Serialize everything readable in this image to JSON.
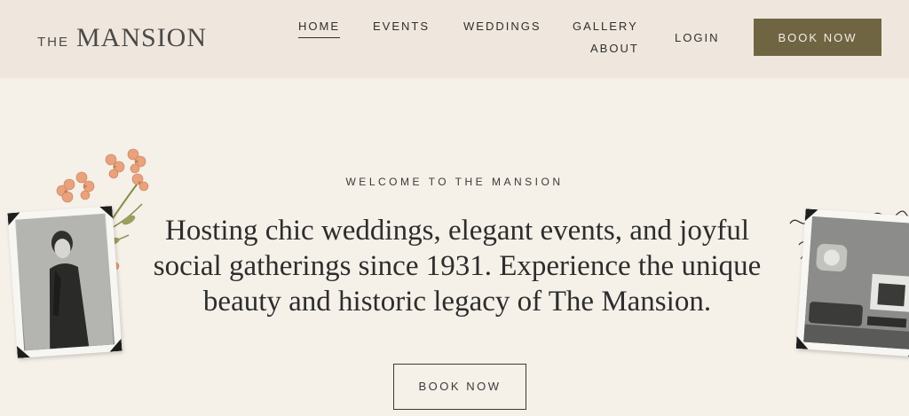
{
  "header": {
    "logo_small": "THE",
    "logo_big": "MANSION",
    "nav": {
      "home": "HOME",
      "events": "EVENTS",
      "weddings": "WEDDINGS",
      "gallery": "GALLERY",
      "about": "ABOUT",
      "login": "LOGIN"
    },
    "book_button": "BOOK NOW"
  },
  "hero": {
    "kicker": "WELCOME TO THE MANSION",
    "headline": "Hosting chic weddings, elegant events, and joyful social gatherings since 1931. Experience the unique beauty and historic legacy of The Mansion.",
    "book_button": "BOOK NOW"
  },
  "colors": {
    "header_bg": "#efe7dd",
    "page_bg": "#f5f0e8",
    "accent": "#6f6543",
    "flower": "#e8a27c"
  }
}
